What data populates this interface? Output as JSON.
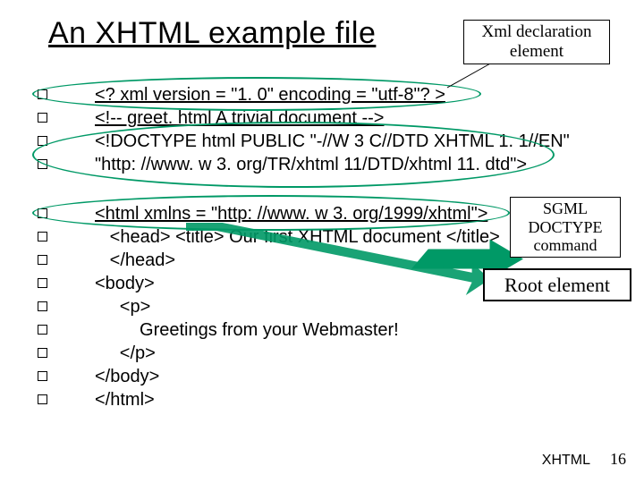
{
  "title": "An XHTML example file",
  "callouts": {
    "xml_decl": "Xml declaration\nelement",
    "sgml": "SGML\nDOCTYPE\ncommand",
    "root": "Root element"
  },
  "lines": {
    "l1": "<? xml version = \"1. 0\" encoding = \"utf-8\"? >",
    "l2": "<!-- greet. html A trivial document -->",
    "l3": "<!DOCTYPE html PUBLIC \"-//W 3 C//DTD XHTML 1. 1//EN\"",
    "l4": "\"http: //www. w 3. org/TR/xhtml 11/DTD/xhtml 11. dtd\">",
    "l5": "<html xmlns = \"http: //www. w 3. org/1999/xhtml\">",
    "l6": "   <head> <title> Our first XHTML document </title>",
    "l7": "   </head>",
    "l8": "<body>",
    "l9": "     <p>",
    "l10": "         Greetings from your Webmaster!",
    "l11": "     </p>",
    "l12": "</body>",
    "l13": "</html>"
  },
  "footer": {
    "label": "XHTML",
    "page": "16"
  }
}
